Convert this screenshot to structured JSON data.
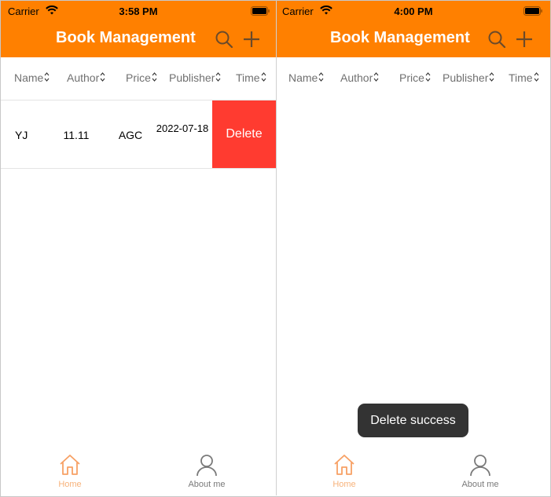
{
  "left_screen": {
    "status": {
      "carrier": "Carrier",
      "time": "3:58 PM"
    },
    "title": "Book Management",
    "columns": [
      {
        "label": "Name"
      },
      {
        "label": "Author"
      },
      {
        "label": "Price"
      },
      {
        "label": "Publisher"
      },
      {
        "label": "Time"
      }
    ],
    "row": {
      "name": "YJ",
      "author": "11.11",
      "price": "AGC",
      "publisher": "2022-07-18",
      "delete_label": "Delete"
    },
    "tabs": {
      "home": "Home",
      "about": "About me"
    }
  },
  "right_screen": {
    "status": {
      "carrier": "Carrier",
      "time": "4:00 PM"
    },
    "title": "Book Management",
    "columns": [
      {
        "label": "Name"
      },
      {
        "label": "Author"
      },
      {
        "label": "Price"
      },
      {
        "label": "Publisher"
      },
      {
        "label": "Time"
      }
    ],
    "toast": "Delete success",
    "tabs": {
      "home": "Home",
      "about": "About me"
    }
  },
  "colors": {
    "header": "#ff8000",
    "delete": "#ff3b30",
    "home_active": "#f7a064",
    "toast_bg": "#333333"
  },
  "icons": {
    "search": "search-icon",
    "add": "plus-icon",
    "sort": "sort-icon",
    "home": "home-icon",
    "about": "person-icon",
    "wifi": "wifi-icon",
    "battery": "battery-icon"
  }
}
